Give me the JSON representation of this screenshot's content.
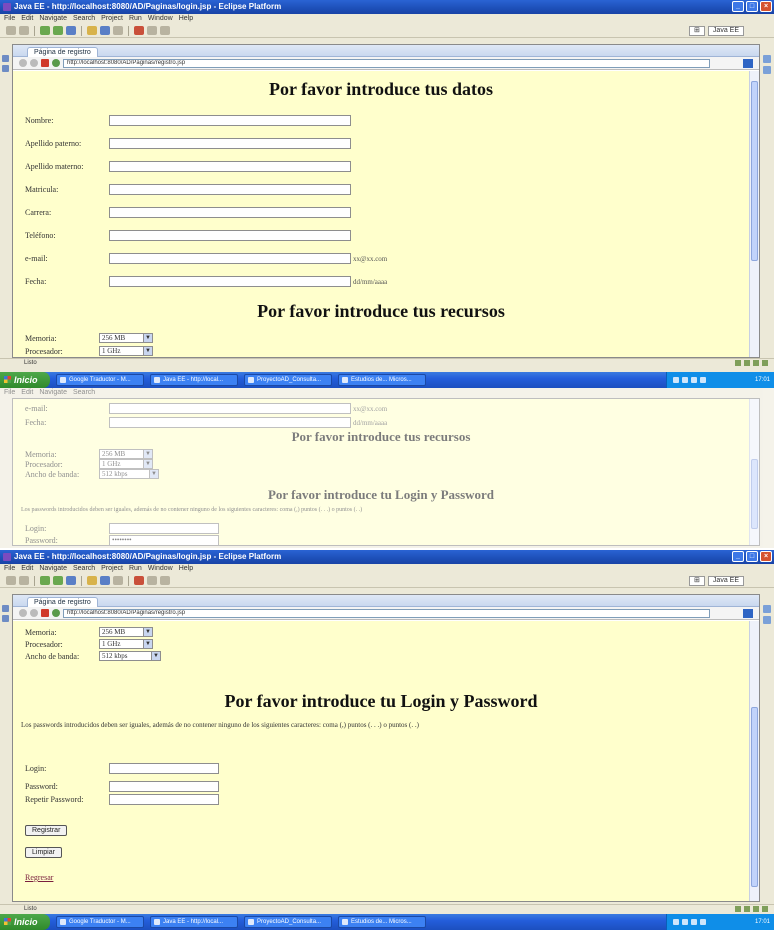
{
  "window": {
    "title": "Java EE - http://localhost:8080/AD/Paginas/login.jsp - Eclipse Platform",
    "menu": [
      "File",
      "Edit",
      "Navigate",
      "Search",
      "Project",
      "Run",
      "Window",
      "Help"
    ],
    "perspective": "Java EE"
  },
  "browser": {
    "tab": "Página de registro",
    "url": "http://localhost:8080/AD/Paginas/registro.jsp"
  },
  "form": {
    "title_datos": "Por favor introduce tus datos",
    "fields": [
      {
        "label": "Nombre:",
        "hint": ""
      },
      {
        "label": "Apellido paterno:",
        "hint": ""
      },
      {
        "label": "Apellido materno:",
        "hint": ""
      },
      {
        "label": "Matricula:",
        "hint": ""
      },
      {
        "label": "Carrera:",
        "hint": ""
      },
      {
        "label": "Teléfono:",
        "hint": ""
      },
      {
        "label": "e-mail:",
        "hint": "xx@xx.com"
      },
      {
        "label": "Fecha:",
        "hint": "dd/mm/aaaa"
      }
    ],
    "title_recursos": "Por favor introduce tus recursos",
    "resources": [
      {
        "label": "Memoria:",
        "value": "256 MB"
      },
      {
        "label": "Procesador:",
        "value": "1 GHz"
      },
      {
        "label": "Ancho de banda:",
        "value": "512 kbps"
      }
    ],
    "title_login": "Por favor introduce tu Login y Password",
    "password_note": "Los passwords introducidos deben ser iguales, además de no contener ninguno de los siguientes caracteres: coma (,) puntos (. . .) o puntos (. .)",
    "login_label": "Login:",
    "password_label": "Password:",
    "repeat_label": "Repetir Password:",
    "password_mask": "••••••••",
    "btn_register": "Registrar",
    "btn_clear": "Limpiar",
    "link_back": "Regresar"
  },
  "status": {
    "text": "Listo"
  },
  "taskbar": {
    "start": "Inicio",
    "tasks": [
      "Google Traductor - M...",
      "Java EE - http://local...",
      "ProyectoAD_Consulta...",
      "Estudios de... Micros..."
    ],
    "clock": "17:01"
  }
}
